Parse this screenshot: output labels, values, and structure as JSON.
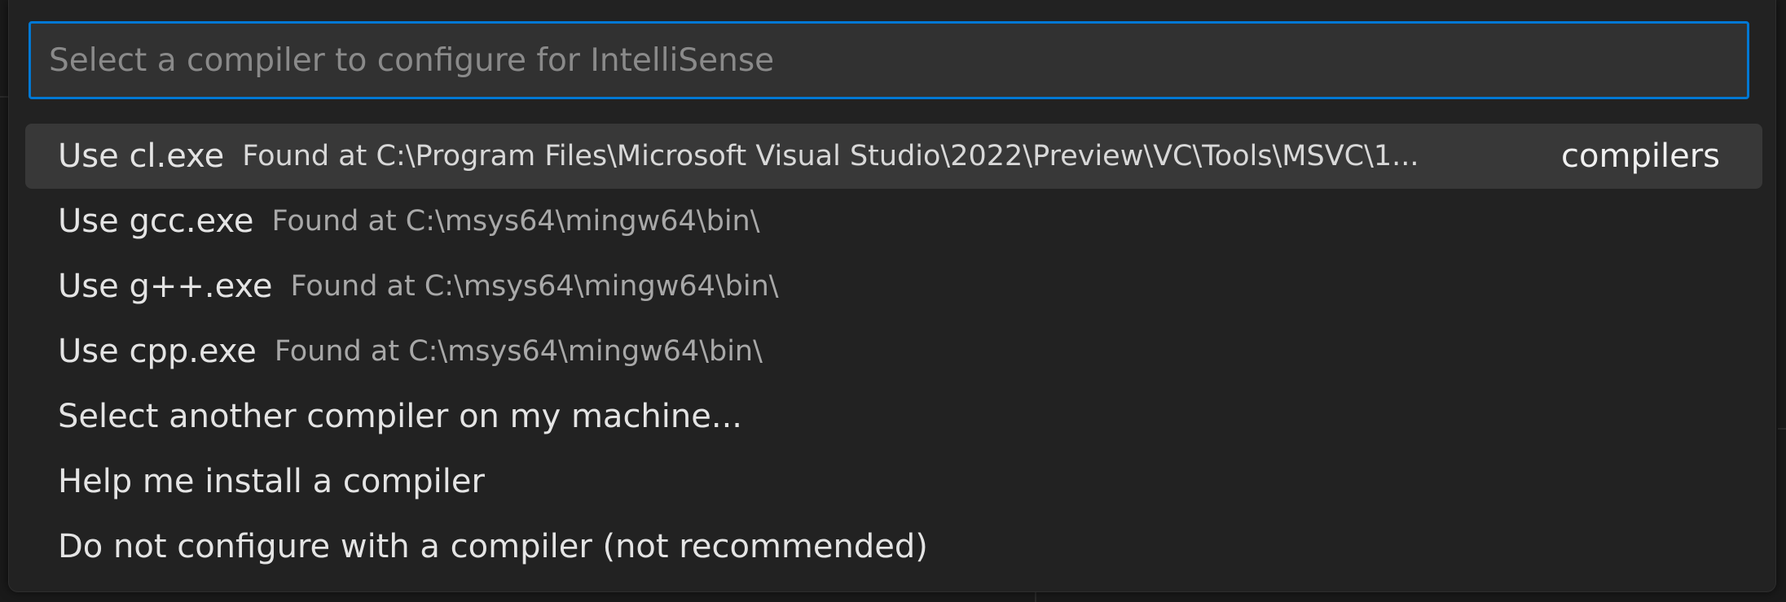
{
  "search": {
    "placeholder": "Select a compiler to configure for IntelliSense",
    "value": ""
  },
  "items": [
    {
      "label": "Use cl.exe",
      "description": "Found at C:\\Program Files\\Microsoft Visual Studio\\2022\\Preview\\VC\\Tools\\MSVC\\1...",
      "tag": "compilers",
      "selected": true
    },
    {
      "label": "Use gcc.exe",
      "description": "Found at C:\\msys64\\mingw64\\bin\\"
    },
    {
      "label": "Use g++.exe",
      "description": "Found at C:\\msys64\\mingw64\\bin\\"
    },
    {
      "label": "Use cpp.exe",
      "description": "Found at C:\\msys64\\mingw64\\bin\\"
    },
    {
      "label": "Select another compiler on my machine..."
    },
    {
      "label": "Help me install a compiler"
    },
    {
      "label": "Do not configure with a compiler (not recommended)"
    }
  ],
  "colors": {
    "accent_border": "#0078d4",
    "panel_background": "#222222",
    "selected_row": "#383838"
  }
}
